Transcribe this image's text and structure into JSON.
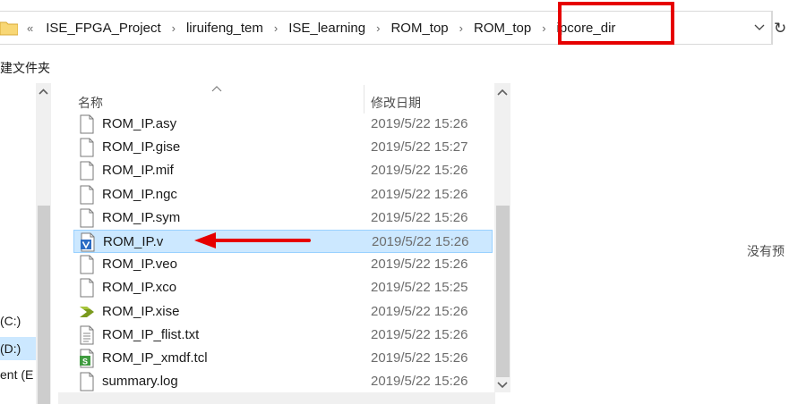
{
  "address_bar": {
    "overflow_glyph": "«",
    "crumbs": [
      "ISE_FPGA_Project",
      "liruifeng_tem",
      "ISE_learning",
      "ROM_top",
      "ROM_top",
      "ipcore_dir"
    ],
    "separator": "›",
    "refresh_glyph": "↻",
    "highlight_color": "#e60000"
  },
  "toolbar": {
    "label": "建文件夹"
  },
  "nav": {
    "drives": [
      "(C:)",
      "(D:)",
      "ent (E"
    ],
    "selected_index": 1
  },
  "file_list": {
    "columns": {
      "name": "名称",
      "date": "修改日期"
    },
    "sort_glyph": "^",
    "files": [
      {
        "name": "ROM_IP.asy",
        "date": "2019/5/22 15:26",
        "icon": "blank-file-icon"
      },
      {
        "name": "ROM_IP.gise",
        "date": "2019/5/22 15:27",
        "icon": "blank-file-icon"
      },
      {
        "name": "ROM_IP.mif",
        "date": "2019/5/22 15:26",
        "icon": "blank-file-icon"
      },
      {
        "name": "ROM_IP.ngc",
        "date": "2019/5/22 15:26",
        "icon": "blank-file-icon"
      },
      {
        "name": "ROM_IP.sym",
        "date": "2019/5/22 15:26",
        "icon": "blank-file-icon"
      },
      {
        "name": "ROM_IP.v",
        "date": "2019/5/22 15:26",
        "icon": "verilog-file-icon"
      },
      {
        "name": "ROM_IP.veo",
        "date": "2019/5/22 15:26",
        "icon": "blank-file-icon"
      },
      {
        "name": "ROM_IP.xco",
        "date": "2019/5/22 15:25",
        "icon": "blank-file-icon"
      },
      {
        "name": "ROM_IP.xise",
        "date": "2019/5/22 15:26",
        "icon": "xilinx-project-icon"
      },
      {
        "name": "ROM_IP_flist.txt",
        "date": "2019/5/22 15:26",
        "icon": "text-file-icon"
      },
      {
        "name": "ROM_IP_xmdf.tcl",
        "date": "2019/5/22 15:26",
        "icon": "tcl-script-icon"
      },
      {
        "name": "summary.log",
        "date": "2019/5/22 15:26",
        "icon": "blank-file-icon"
      }
    ],
    "selected_index": 5,
    "selection_color": "#cce8ff"
  },
  "annotation": {
    "arrow_color": "#e60000"
  },
  "preview": {
    "text": "没有预"
  }
}
